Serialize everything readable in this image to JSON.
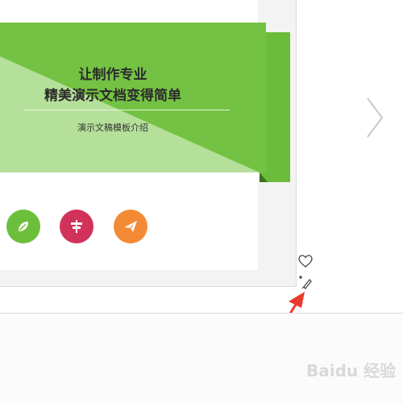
{
  "slide": {
    "title_line1": "让制作专业",
    "title_line2": "精美演示文档变得简单",
    "subtitle": "演示文稿模板介绍"
  },
  "icons": [
    {
      "name": "leaf-icon",
      "color": "#6dbf3b"
    },
    {
      "name": "signpost-icon",
      "color": "#d1325a"
    },
    {
      "name": "airplane-icon",
      "color": "#f38a35"
    }
  ],
  "colors": {
    "banner_green": "#74c243",
    "banner_dark_green": "#5fa832",
    "banner_light_green": "#b5e09a",
    "arrow_red": "#e83a2e"
  },
  "watermark": "Baidu 经验"
}
